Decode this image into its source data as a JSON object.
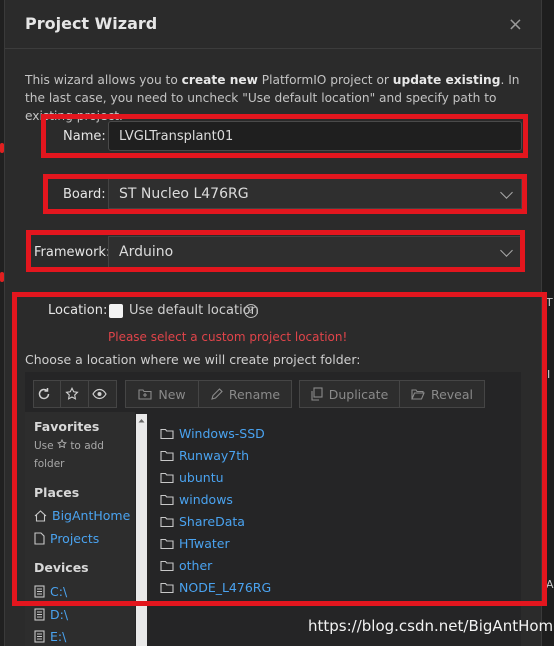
{
  "dialog": {
    "title": "Project Wizard",
    "close": "×",
    "description": {
      "p1": "This wizard allows you to ",
      "b1": "create new",
      "p2": " PlatformIO project or ",
      "b2": "update existing",
      "p3": ". In the last case, you need to uncheck \"Use default location\" and specify path to existing project."
    }
  },
  "form": {
    "name_label": "Name:",
    "name_value": "LVGLTransplant01",
    "board_label": "Board:",
    "board_value": "ST Nucleo L476RG",
    "framework_label": "Framework:",
    "framework_value": "Arduino",
    "location_label": "Location:",
    "use_default_label": "Use default location",
    "help": "?",
    "error": "Please select a custom project location!",
    "choose_text": "Choose a location where we will create project folder:"
  },
  "toolbar": {
    "new": "New",
    "rename": "Rename",
    "duplicate": "Duplicate",
    "reveal": "Reveal"
  },
  "sidebar": {
    "favorites_title": "Favorites",
    "favorites_hint_a": "Use",
    "favorites_hint_b": "to add folder",
    "places_title": "Places",
    "places": [
      "BigAntHome",
      "Projects"
    ],
    "devices_title": "Devices",
    "devices": [
      "C:\\",
      "D:\\",
      "E:\\"
    ]
  },
  "folders": [
    "Windows-SSD",
    "Runway7th",
    "ubuntu",
    "windows",
    "ShareData",
    "HTwater",
    "other",
    "NODE_L476RG"
  ],
  "background": {
    "right_letters": [
      "T",
      "I",
      "A"
    ]
  },
  "watermark": "https://blog.csdn.net/BigAntHome",
  "colors": {
    "highlight_box": "#e3161e",
    "link": "#4aa3f0",
    "error": "#e0444a"
  }
}
